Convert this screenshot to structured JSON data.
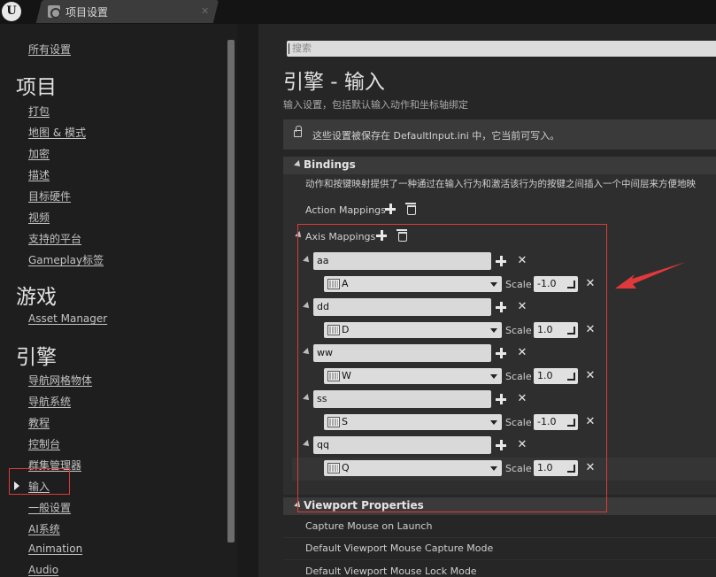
{
  "titlebar": {
    "logo": "U",
    "tab_title": "项目设置",
    "tab_icon": "settings-icon",
    "close": "✕"
  },
  "sidebar": {
    "all_settings": "所有设置",
    "project_heading": "项目",
    "project_items": [
      "打包",
      "地图 & 模式",
      "加密",
      "描述",
      "目标硬件",
      "视频",
      "支持的平台",
      "Gameplay标签"
    ],
    "game_heading": "游戏",
    "game_items": [
      "Asset Manager"
    ],
    "engine_heading": "引擎",
    "engine_items": [
      "导航网格物体",
      "导航系统",
      "教程",
      "控制台",
      "群集管理器",
      "输入",
      "一般设置",
      "AI系统",
      "Animation",
      "Audio"
    ],
    "selected_item": "输入"
  },
  "main": {
    "search_placeholder": "搜索",
    "title": "引擎 - 输入",
    "subtitle": "输入设置，包括默认输入动作和坐标轴绑定",
    "notice": "这些设置被保存在 DefaultInput.ini 中，它当前可写入。",
    "bindings": {
      "label": "Bindings",
      "description": "动作和按键映射提供了一种通过在输入行为和激活该行为的按键之间插入一个中间层来方便地映",
      "action_mappings": "Action Mappings",
      "axis_mappings": "Axis Mappings",
      "scale_label": "Scale",
      "axes": [
        {
          "name": "aa",
          "key": "A",
          "scale": "-1.0"
        },
        {
          "name": "dd",
          "key": "D",
          "scale": "1.0"
        },
        {
          "name": "ww",
          "key": "W",
          "scale": "1.0"
        },
        {
          "name": "ss",
          "key": "S",
          "scale": "-1.0"
        },
        {
          "name": "qq",
          "key": "Q",
          "scale": "1.0"
        }
      ]
    },
    "viewport": {
      "label": "Viewport Properties",
      "rows": [
        "Capture Mouse on Launch",
        "Default Viewport Mouse Capture Mode",
        "Default Viewport Mouse Lock Mode"
      ]
    }
  },
  "colors": {
    "annotation_red": "#e0393b",
    "background": "#262626",
    "sidebar": "#1e1e1e"
  }
}
